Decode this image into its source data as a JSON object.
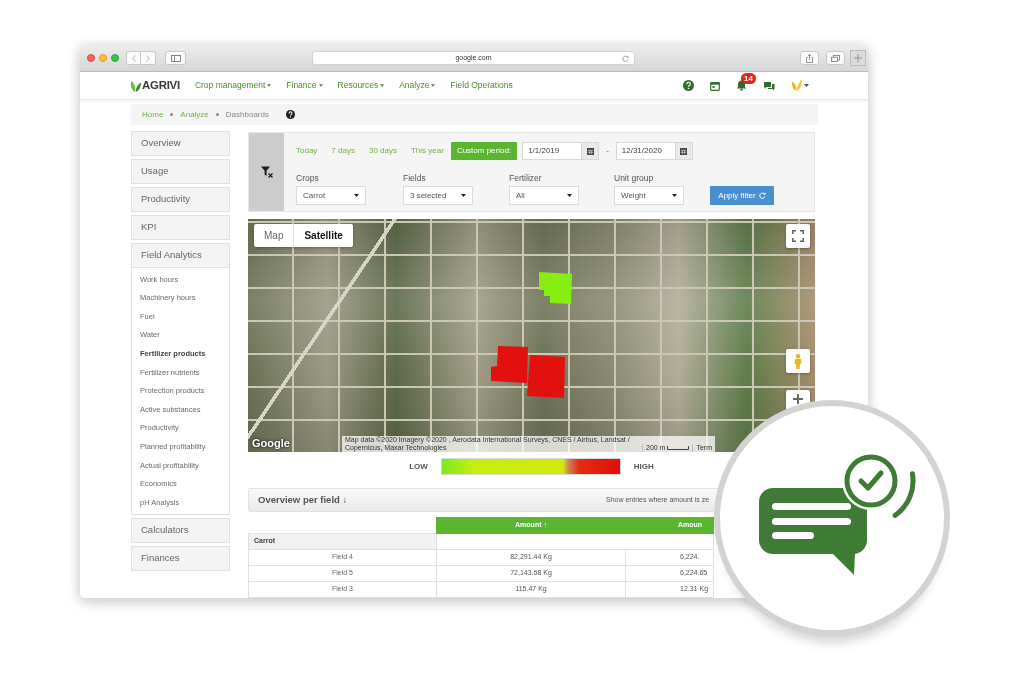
{
  "browser": {
    "address": "google.com"
  },
  "nav": {
    "logo": "AGRIVI",
    "menu": [
      {
        "label": "Crop management",
        "dropdown": true
      },
      {
        "label": "Finance",
        "dropdown": true
      },
      {
        "label": "Resources",
        "dropdown": true
      },
      {
        "label": "Analyze",
        "dropdown": true
      },
      {
        "label": "Field Operations",
        "dropdown": false
      }
    ],
    "notifications": "14"
  },
  "breadcrumb": [
    {
      "label": "Home",
      "current": false
    },
    {
      "label": "Analyze",
      "current": false
    },
    {
      "label": "Dashboards",
      "current": true
    }
  ],
  "sidebar": {
    "items": [
      {
        "label": "Overview"
      },
      {
        "label": "Usage"
      },
      {
        "label": "Productivity"
      },
      {
        "label": "KPI"
      },
      {
        "label": "Field Analytics",
        "children": [
          {
            "label": "Work hours",
            "selected": false
          },
          {
            "label": "Machinery hours",
            "selected": false
          },
          {
            "label": "Fuel",
            "selected": false
          },
          {
            "label": "Water",
            "selected": false
          },
          {
            "label": "Fertilizer products",
            "selected": true
          },
          {
            "label": "Fertilizer nutrients",
            "selected": false
          },
          {
            "label": "Protection products",
            "selected": false
          },
          {
            "label": "Active substances",
            "selected": false
          },
          {
            "label": "Productivity",
            "selected": false
          },
          {
            "label": "Planned profitability",
            "selected": false
          },
          {
            "label": "Actual profitability",
            "selected": false
          },
          {
            "label": "Economics",
            "selected": false
          },
          {
            "label": "pH Analysis",
            "selected": false
          }
        ]
      },
      {
        "label": "Calculators"
      },
      {
        "label": "Finances"
      }
    ]
  },
  "filters": {
    "periods": [
      {
        "label": "Today",
        "selected": false
      },
      {
        "label": "7 days",
        "selected": false
      },
      {
        "label": "30 days",
        "selected": false
      },
      {
        "label": "This year",
        "selected": false
      },
      {
        "label": "Custom period:",
        "selected": true
      }
    ],
    "date_from": "1/1/2019",
    "date_separator": "-",
    "date_to": "12/31/2020",
    "selects": [
      {
        "label": "Crops",
        "value": "Carrot"
      },
      {
        "label": "Fields",
        "value": "3 selected"
      },
      {
        "label": "Fertilizer",
        "value": "All"
      },
      {
        "label": "Unit group",
        "value": "Weight"
      }
    ],
    "apply_button": "Apply filter"
  },
  "map": {
    "tabs": [
      {
        "label": "Map",
        "selected": false
      },
      {
        "label": "Satellite",
        "selected": true
      }
    ],
    "fields": [
      {
        "color": "#86ee10"
      },
      {
        "color": "#e2100e"
      },
      {
        "color": "#e2100e"
      }
    ],
    "logo": "Google",
    "attribution": "Map data ©2020 Imagery ©2020 , Aerodata International Surveys, CNES / Airbus, Landsat / Copernicus, Maxar Technologies",
    "scale": "200 m",
    "terms": "Term"
  },
  "legend": {
    "low": "LOW",
    "high": "HIGH"
  },
  "overview": {
    "title": "Overview per field ↓",
    "note": "Show entries where amount is ze"
  },
  "table": {
    "columns": [
      "Amount ↑",
      "Amoun"
    ],
    "groups": [
      {
        "name": "Carrot",
        "rows": [
          {
            "label": "Field 4",
            "cells": [
              "82,291.44 Kg",
              "6,224."
            ]
          },
          {
            "label": "Field 5",
            "cells": [
              "72,143.68 Kg",
              "6,224.65"
            ]
          },
          {
            "label": "Field 3",
            "cells": [
              "115.47 Kg",
              "12.31 Kg"
            ]
          }
        ]
      }
    ]
  }
}
